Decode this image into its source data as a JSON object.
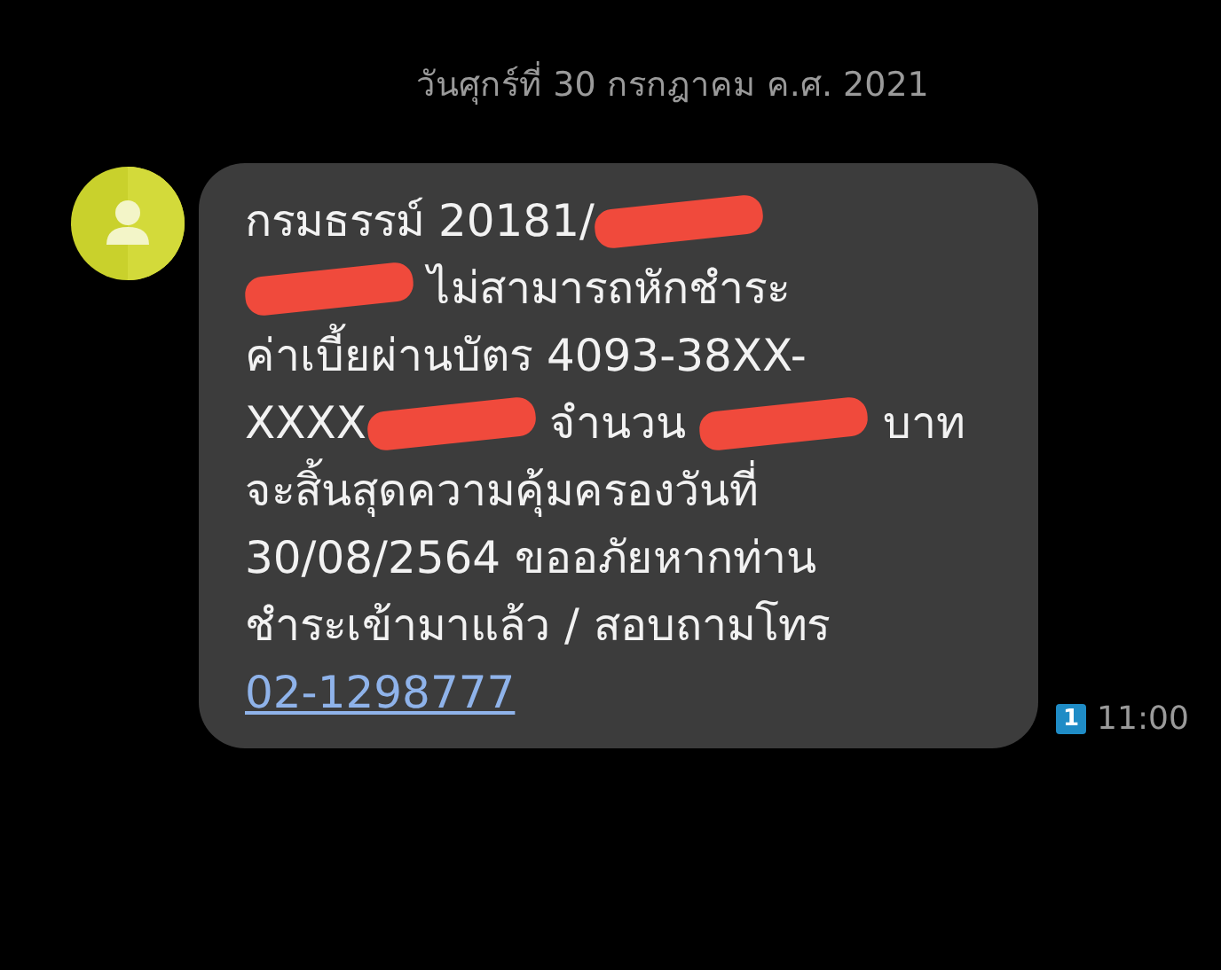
{
  "date_header": "วันศุกร์ที่ 30 กรกฎาคม ค.ศ. 2021",
  "message": {
    "lines": [
      [
        {
          "kind": "text",
          "text": "กรมธรรม์ 20181/"
        },
        {
          "kind": "redaction"
        }
      ],
      [
        {
          "kind": "redaction"
        },
        {
          "kind": "text",
          "text": " ไม่สามารถหักชำระ"
        }
      ],
      [
        {
          "kind": "text",
          "text": "ค่าเบี้ยผ่านบัตร 4093-38XX-"
        }
      ],
      [
        {
          "kind": "text",
          "text": "XXXX"
        },
        {
          "kind": "redaction"
        },
        {
          "kind": "text",
          "text": " จำนวน "
        },
        {
          "kind": "redaction"
        },
        {
          "kind": "text",
          "text": " บาท"
        }
      ],
      [
        {
          "kind": "text",
          "text": "จะสิ้นสุดความคุ้มครองวันที่"
        }
      ],
      [
        {
          "kind": "text",
          "text": "30/08/2564 ขออภัยหากท่าน"
        }
      ],
      [
        {
          "kind": "text",
          "text": "ชำระเข้ามาแล้ว / สอบถามโทร"
        }
      ],
      [
        {
          "kind": "link",
          "text": "02-1298777"
        }
      ]
    ],
    "sim": "1",
    "time": "11:00"
  }
}
